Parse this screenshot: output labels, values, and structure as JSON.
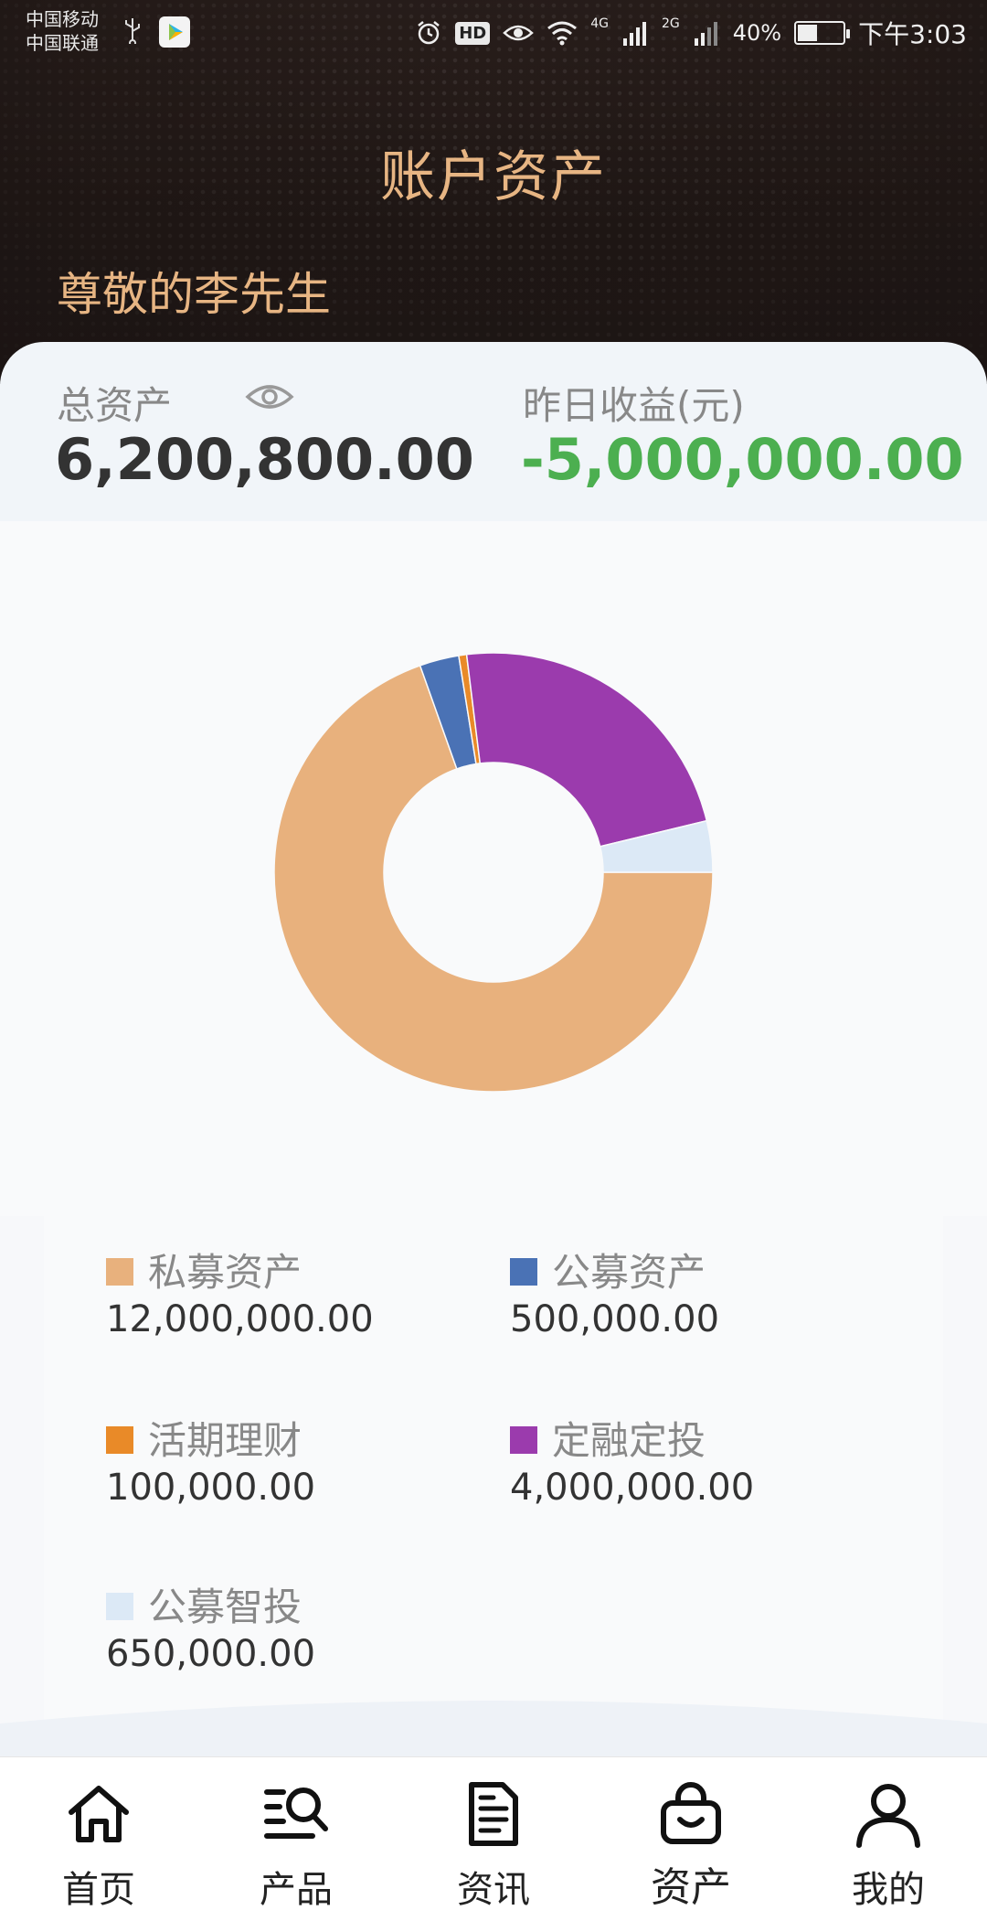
{
  "status_bar": {
    "carrier_1": "中国移动",
    "carrier_2": "中国联通",
    "hd": "HD",
    "net_1": "4G",
    "net_2": "2G",
    "battery": "40%",
    "time": "下午3:03"
  },
  "header": {
    "title": "账户资产",
    "greeting": "尊敬的李先生"
  },
  "summary": {
    "total_label": "总资产",
    "total_value": "6,200,800.00",
    "yesterday_label": "昨日收益(元)",
    "yesterday_value": "-5,000,000.00",
    "yesterday_color": "#4caf50"
  },
  "chart_data": {
    "type": "pie",
    "categories": [
      "私募资产",
      "公募资产",
      "活期理财",
      "定融定投",
      "公募智投"
    ],
    "values": [
      12000000,
      500000,
      100000,
      4000000,
      650000
    ],
    "colors": [
      "#e8b17d",
      "#4a72b5",
      "#e98a28",
      "#9b3bad",
      "#dce9f6"
    ],
    "start_angle_deg": 90,
    "direction": "clockwise",
    "inner_radius_ratio": 0.5,
    "legend_position": "bottom"
  },
  "legend": {
    "items": [
      {
        "name": "私募资产",
        "value": "12,000,000.00",
        "color": "#e8b17d"
      },
      {
        "name": "公募资产",
        "value": "500,000.00",
        "color": "#4a72b5"
      },
      {
        "name": "活期理财",
        "value": "100,000.00",
        "color": "#e98a28"
      },
      {
        "name": "定融定投",
        "value": "4,000,000.00",
        "color": "#9b3bad"
      },
      {
        "name": "公募智投",
        "value": "650,000.00",
        "color": "#dce9f6"
      }
    ]
  },
  "nav": {
    "items": [
      {
        "label": "首页",
        "icon": "home-icon"
      },
      {
        "label": "产品",
        "icon": "product-search-icon"
      },
      {
        "label": "资讯",
        "icon": "document-icon"
      },
      {
        "label": "资产",
        "icon": "bag-icon"
      },
      {
        "label": "我的",
        "icon": "user-icon"
      }
    ],
    "active_index": 3
  }
}
